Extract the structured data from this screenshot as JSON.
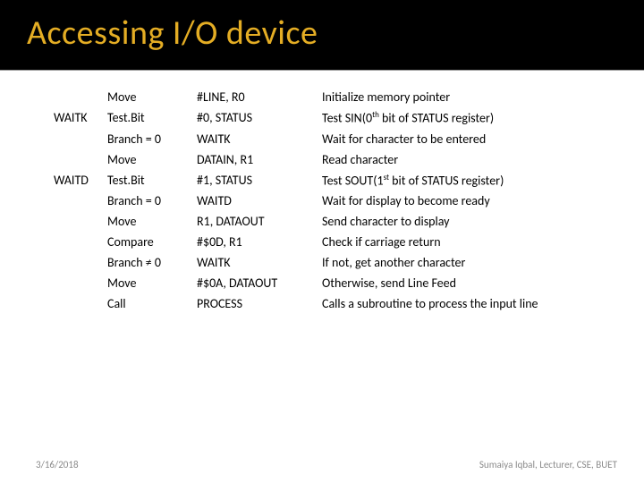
{
  "title": "Accessing I/O device",
  "rows": [
    {
      "label": "",
      "instr": "Move",
      "operand": "#LINE, R0",
      "comment": "Initialize memory pointer"
    },
    {
      "label": "WAITK",
      "instr": "Test.Bit",
      "operand": "#0, STATUS",
      "comment_pre": "Test SIN(0",
      "comment_sup": "th",
      "comment_post": " bit of STATUS register)"
    },
    {
      "label": "",
      "instr": "Branch = 0",
      "operand": "WAITK",
      "comment": "Wait for character to be entered"
    },
    {
      "label": "",
      "instr": "Move",
      "operand": "DATAIN, R1",
      "comment": "Read character"
    },
    {
      "label": "WAITD",
      "instr": "Test.Bit",
      "operand": "#1, STATUS",
      "comment_pre": "Test SOUT(1",
      "comment_sup": "st",
      "comment_post": " bit of STATUS register)"
    },
    {
      "label": "",
      "instr": "Branch = 0",
      "operand": "WAITD",
      "comment": "Wait for display to become ready"
    },
    {
      "label": "",
      "instr": "Move",
      "operand": "R1, DATAOUT",
      "comment": "Send character to display"
    },
    {
      "label": "",
      "instr": "Compare",
      "operand": "#$0D, R1",
      "comment": "Check if carriage return"
    },
    {
      "label": "",
      "instr": "Branch ≠ 0",
      "operand": "WAITK",
      "comment": "If not, get another character"
    },
    {
      "label": "",
      "instr": "Move",
      "operand": "#$0A, DATAOUT",
      "comment": "Otherwise, send Line Feed"
    },
    {
      "label": "",
      "instr": "Call",
      "operand": "PROCESS",
      "comment": "Calls a subroutine to process the input line"
    }
  ],
  "footer": {
    "date": "3/16/2018",
    "credit": "Sumaiya Iqbal, Lecturer, CSE, BUET"
  }
}
